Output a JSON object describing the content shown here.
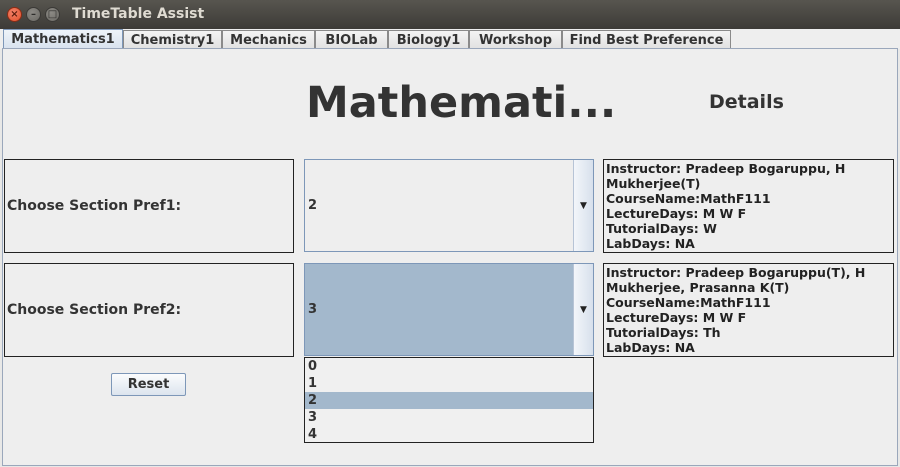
{
  "window": {
    "title": "TimeTable Assist",
    "close_glyph": "×",
    "minimize_glyph": "–",
    "maximize_glyph": "□"
  },
  "tabs": [
    {
      "label": "Mathematics1",
      "active": true
    },
    {
      "label": "Chemistry1",
      "active": false
    },
    {
      "label": "Mechanics",
      "active": false
    },
    {
      "label": "BIOLab",
      "active": false
    },
    {
      "label": "Biology1",
      "active": false
    },
    {
      "label": "Workshop",
      "active": false
    },
    {
      "label": "Find Best Preference",
      "active": false
    }
  ],
  "main": {
    "heading": "Mathemati...",
    "details_heading": "Details",
    "pref1": {
      "label": "Choose Section Pref1:",
      "value": "2",
      "details": [
        "Instructor: Pradeep Bogaruppu, H",
        "Mukherjee(T)",
        "CourseName:MathF111",
        "LectureDays: M W F",
        "TutorialDays: W",
        "LabDays: NA"
      ]
    },
    "pref2": {
      "label": "Choose Section Pref2:",
      "value": "3",
      "details": [
        "Instructor: Pradeep Bogaruppu(T), H",
        "Mukherjee, Prasanna K(T)",
        "CourseName:MathF111",
        "LectureDays: M W F",
        "TutorialDays: Th",
        "LabDays: NA"
      ]
    },
    "reset_label": "Reset",
    "dropdown_options": [
      "0",
      "1",
      "2",
      "3",
      "4"
    ],
    "dropdown_highlighted": "2"
  },
  "icons": {
    "dropdown_arrow": "▼"
  }
}
